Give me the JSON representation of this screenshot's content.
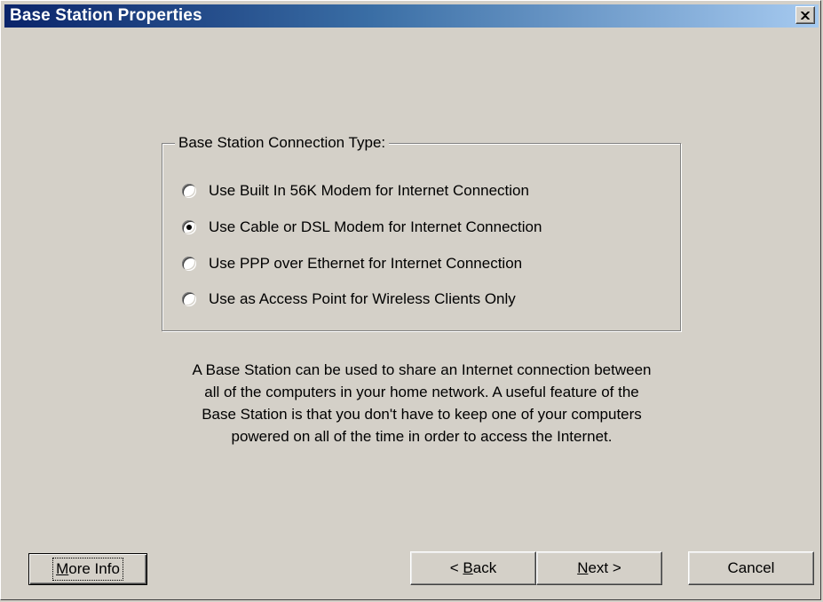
{
  "window": {
    "title": "Base Station Properties",
    "close_symbol": "×"
  },
  "connection_group": {
    "legend": "Base Station Connection Type:",
    "options": [
      {
        "label": "Use Built In 56K Modem for Internet Connection",
        "checked": false
      },
      {
        "label": "Use Cable or DSL Modem for Internet Connection",
        "checked": true
      },
      {
        "label": "Use PPP over Ethernet for Internet Connection",
        "checked": false
      },
      {
        "label": "Use as Access Point for Wireless Clients Only",
        "checked": false
      }
    ]
  },
  "description": {
    "lines": [
      "A Base Station can be used to share an Internet connection between",
      "all of the computers in your home network.  A useful feature of the",
      "Base Station is that you don't have to keep one of your computers",
      "powered on all of the time in order to access the Internet."
    ]
  },
  "buttons": {
    "more_info": {
      "accel": "M",
      "rest": "ore Info"
    },
    "back": {
      "prefix": "< ",
      "accel": "B",
      "rest": "ack"
    },
    "next": {
      "accel": "N",
      "rest": "ext >"
    },
    "cancel": {
      "label": "Cancel"
    }
  },
  "colors": {
    "title_start": "#0a246a",
    "title_end": "#a6caf0",
    "face": "#d4d0c8"
  },
  "icons": {
    "close": "close-icon"
  }
}
